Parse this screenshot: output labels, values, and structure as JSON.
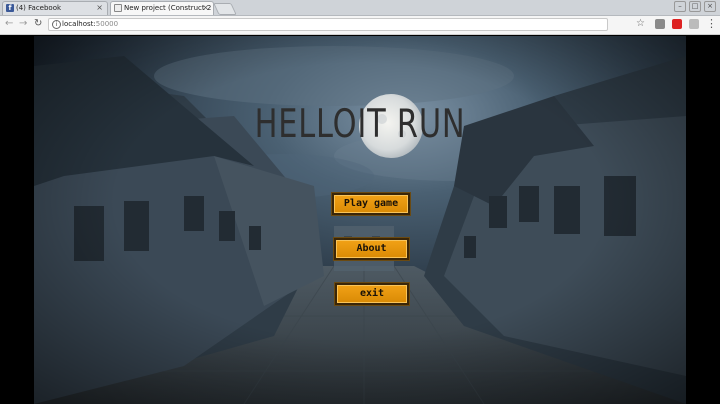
{
  "browser": {
    "tabs": [
      {
        "title": "(4) Facebook",
        "active": false,
        "icon": "facebook-icon"
      },
      {
        "title": "New project (Construct 2",
        "active": true,
        "icon": "page-icon"
      }
    ],
    "close_glyph": "×",
    "address": {
      "host": "localhost:",
      "port": "50000"
    },
    "info_glyph": "i"
  },
  "game": {
    "title": "HELLOIT RUN",
    "menu": {
      "play_label": "Play game",
      "about_label": "About",
      "exit_label": "exit"
    }
  },
  "colors": {
    "button_fill": "#e8960c",
    "button_border": "#3a2608",
    "title_color": "#2e2e2e",
    "sky": "#3c5062"
  }
}
